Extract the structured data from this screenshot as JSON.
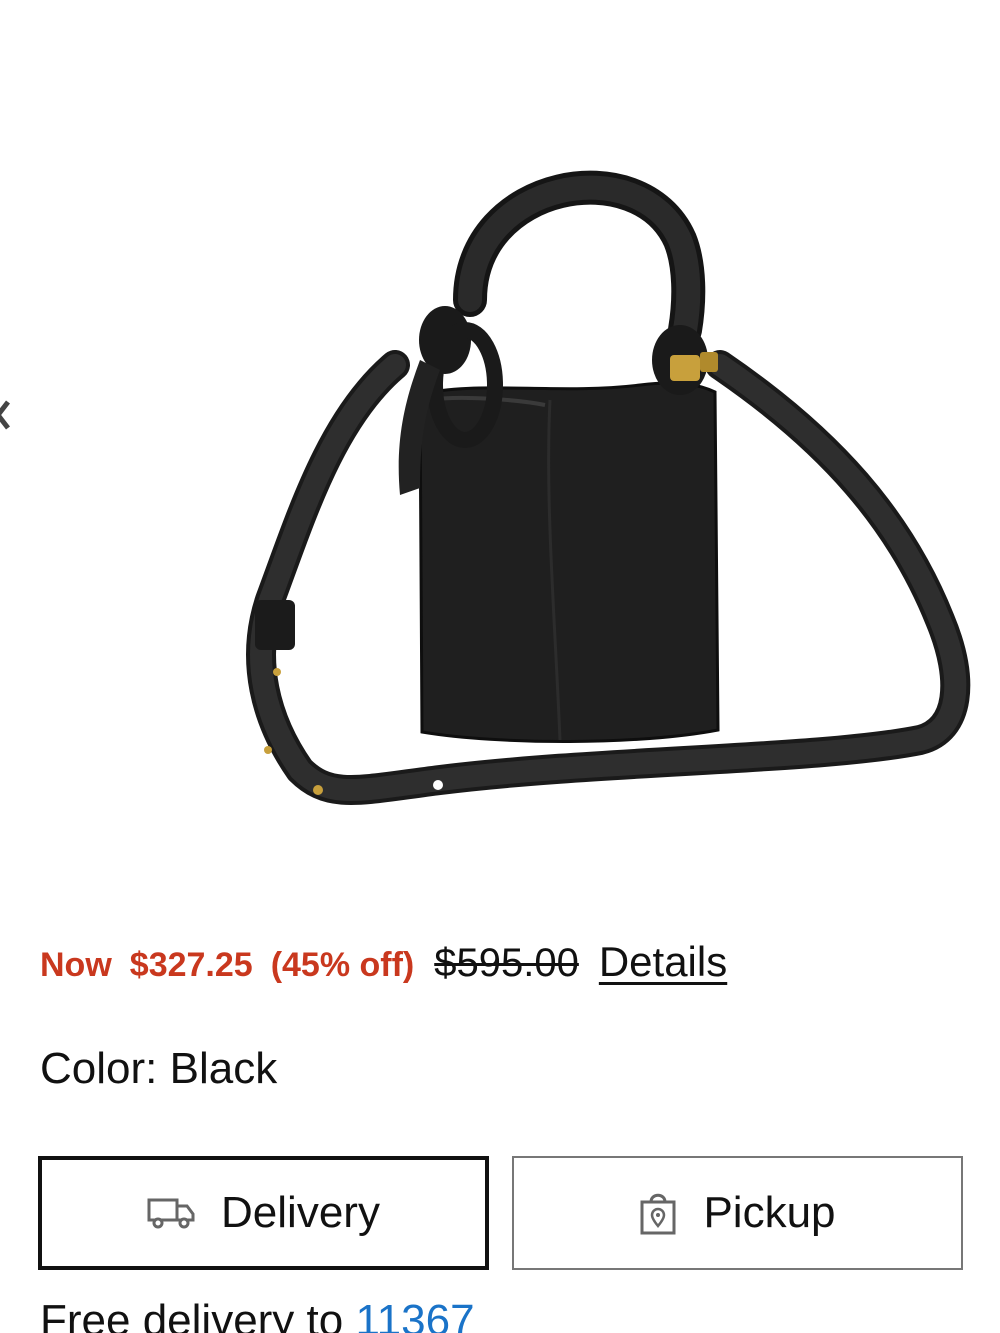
{
  "product": {
    "image_alt": "Black leather bucket bag with knotted top handle and adjustable crossbody strap"
  },
  "price": {
    "now_label": "Now",
    "now_price": "$327.25",
    "discount": "(45% off)",
    "original_price": "$595.00",
    "details_label": "Details"
  },
  "color": {
    "text": "Color: Black"
  },
  "fulfillment": {
    "delivery_label": "Delivery",
    "pickup_label": "Pickup",
    "selected": "Delivery"
  },
  "delivery": {
    "text": "Free delivery to ",
    "zip": "11367"
  },
  "colors": {
    "sale": "#c9381e",
    "link": "#1a73c8",
    "text": "#111111"
  },
  "icons": {
    "prev": "chevron-left-icon",
    "delivery": "truck-icon",
    "pickup": "store-bag-icon"
  }
}
